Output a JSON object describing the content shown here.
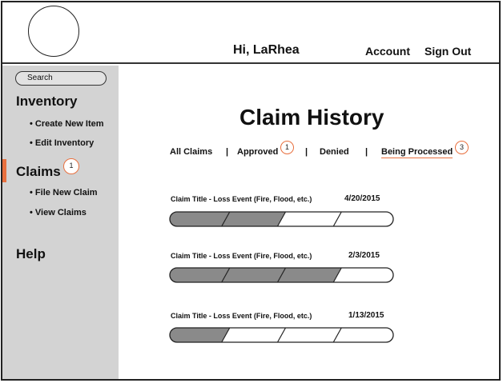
{
  "header": {
    "greeting": "Hi, LaRhea",
    "account_label": "Account",
    "sign_out_label": "Sign Out"
  },
  "sidebar": {
    "search_label": "Search",
    "inventory_title": "Inventory",
    "inventory_items": [
      {
        "label": "Create New Item"
      },
      {
        "label": "Edit Inventory"
      }
    ],
    "claims_title": "Claims",
    "claims_badge": "1",
    "claims_items": [
      {
        "label": "File New Claim"
      },
      {
        "label": "View Claims"
      }
    ],
    "help_title": "Help"
  },
  "main": {
    "title": "Claim History",
    "filters": [
      {
        "label": "All Claims"
      },
      {
        "label": "Approved",
        "badge": "1"
      },
      {
        "label": "Denied"
      },
      {
        "label": "Being Processed",
        "badge": "3"
      }
    ],
    "separator": "|",
    "claims": [
      {
        "title": "Claim Title - Loss Event (Fire, Flood, etc.)",
        "date": "4/20/2015",
        "progress_steps": 2,
        "total_steps": 4
      },
      {
        "title": "Claim Title - Loss Event (Fire, Flood, etc.)",
        "date": "2/3/2015",
        "progress_steps": 3,
        "total_steps": 4
      },
      {
        "title": "Claim Title - Loss Event (Fire, Flood, etc.)",
        "date": "1/13/2015",
        "progress_steps": 1,
        "total_steps": 4
      }
    ]
  },
  "colors": {
    "accent": "#e8703f",
    "sidebar_bg": "#d3d3d3",
    "progress_fill": "#8a8a8a"
  }
}
